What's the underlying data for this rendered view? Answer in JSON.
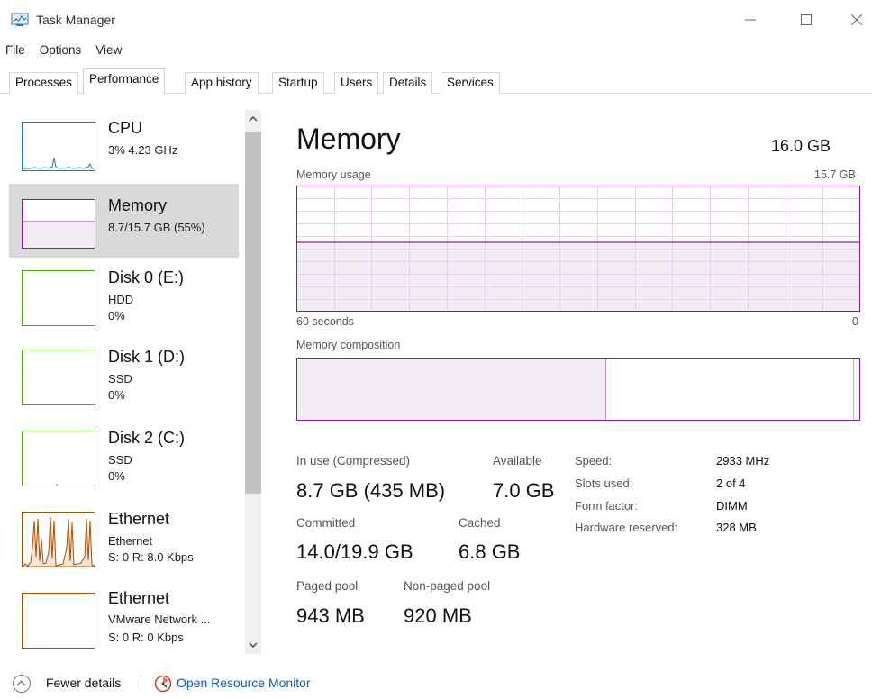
{
  "window": {
    "title": "Task Manager"
  },
  "menu": [
    "File",
    "Options",
    "View"
  ],
  "tabs": [
    "Processes",
    "Performance",
    "App history",
    "Startup",
    "Users",
    "Details",
    "Services"
  ],
  "active_tab": "Performance",
  "sidebar": {
    "items": [
      {
        "name": "CPU",
        "line1": "3% 4.23 GHz",
        "line2": "",
        "color": "#117dbb"
      },
      {
        "name": "Memory",
        "line1": "8.7/15.7 GB (55%)",
        "line2": "",
        "color": "#8b18a8",
        "fill": 0.55
      },
      {
        "name": "Disk 0 (E:)",
        "line1": "HDD",
        "line2": "0%",
        "color": "#4da60c"
      },
      {
        "name": "Disk 1 (D:)",
        "line1": "SSD",
        "line2": "0%",
        "color": "#4da60c"
      },
      {
        "name": "Disk 2 (C:)",
        "line1": "SSD",
        "line2": "0%",
        "color": "#4da60c"
      },
      {
        "name": "Ethernet",
        "line1": "Ethernet",
        "line2": "S: 0 R: 8.0 Kbps",
        "color": "#a74f01"
      },
      {
        "name": "Ethernet",
        "line1": "VMware Network ...",
        "line2": "S: 0 R: 0 Kbps",
        "color": "#a74f01"
      }
    ]
  },
  "memory": {
    "title": "Memory",
    "total": "16.0 GB",
    "usage_label": "Memory usage",
    "usage_max": "15.7 GB",
    "time_left": "60 seconds",
    "time_right": "0",
    "usage_fraction": 0.55,
    "composition_label": "Memory composition",
    "composition": {
      "in_use_fraction": 0.55,
      "standby_fraction": 0.99
    },
    "stats": {
      "in_use_label": "In use (Compressed)",
      "in_use_value": "8.7 GB (435 MB)",
      "available_label": "Available",
      "available_value": "7.0 GB",
      "committed_label": "Committed",
      "committed_value": "14.0/19.9 GB",
      "cached_label": "Cached",
      "cached_value": "6.8 GB",
      "paged_label": "Paged pool",
      "paged_value": "943 MB",
      "nonpaged_label": "Non-paged pool",
      "nonpaged_value": "920 MB"
    },
    "specs": [
      {
        "label": "Speed:",
        "value": "2933 MHz"
      },
      {
        "label": "Slots used:",
        "value": "2 of 4"
      },
      {
        "label": "Form factor:",
        "value": "DIMM"
      },
      {
        "label": "Hardware reserved:",
        "value": "328 MB"
      }
    ]
  },
  "footer": {
    "fewer_details": "Fewer details",
    "open_resmon": "Open Resource Monitor"
  },
  "colors": {
    "memory": "#8b18a8",
    "link": "#0a5cbf",
    "selected_bg": "#d9d9d9"
  }
}
